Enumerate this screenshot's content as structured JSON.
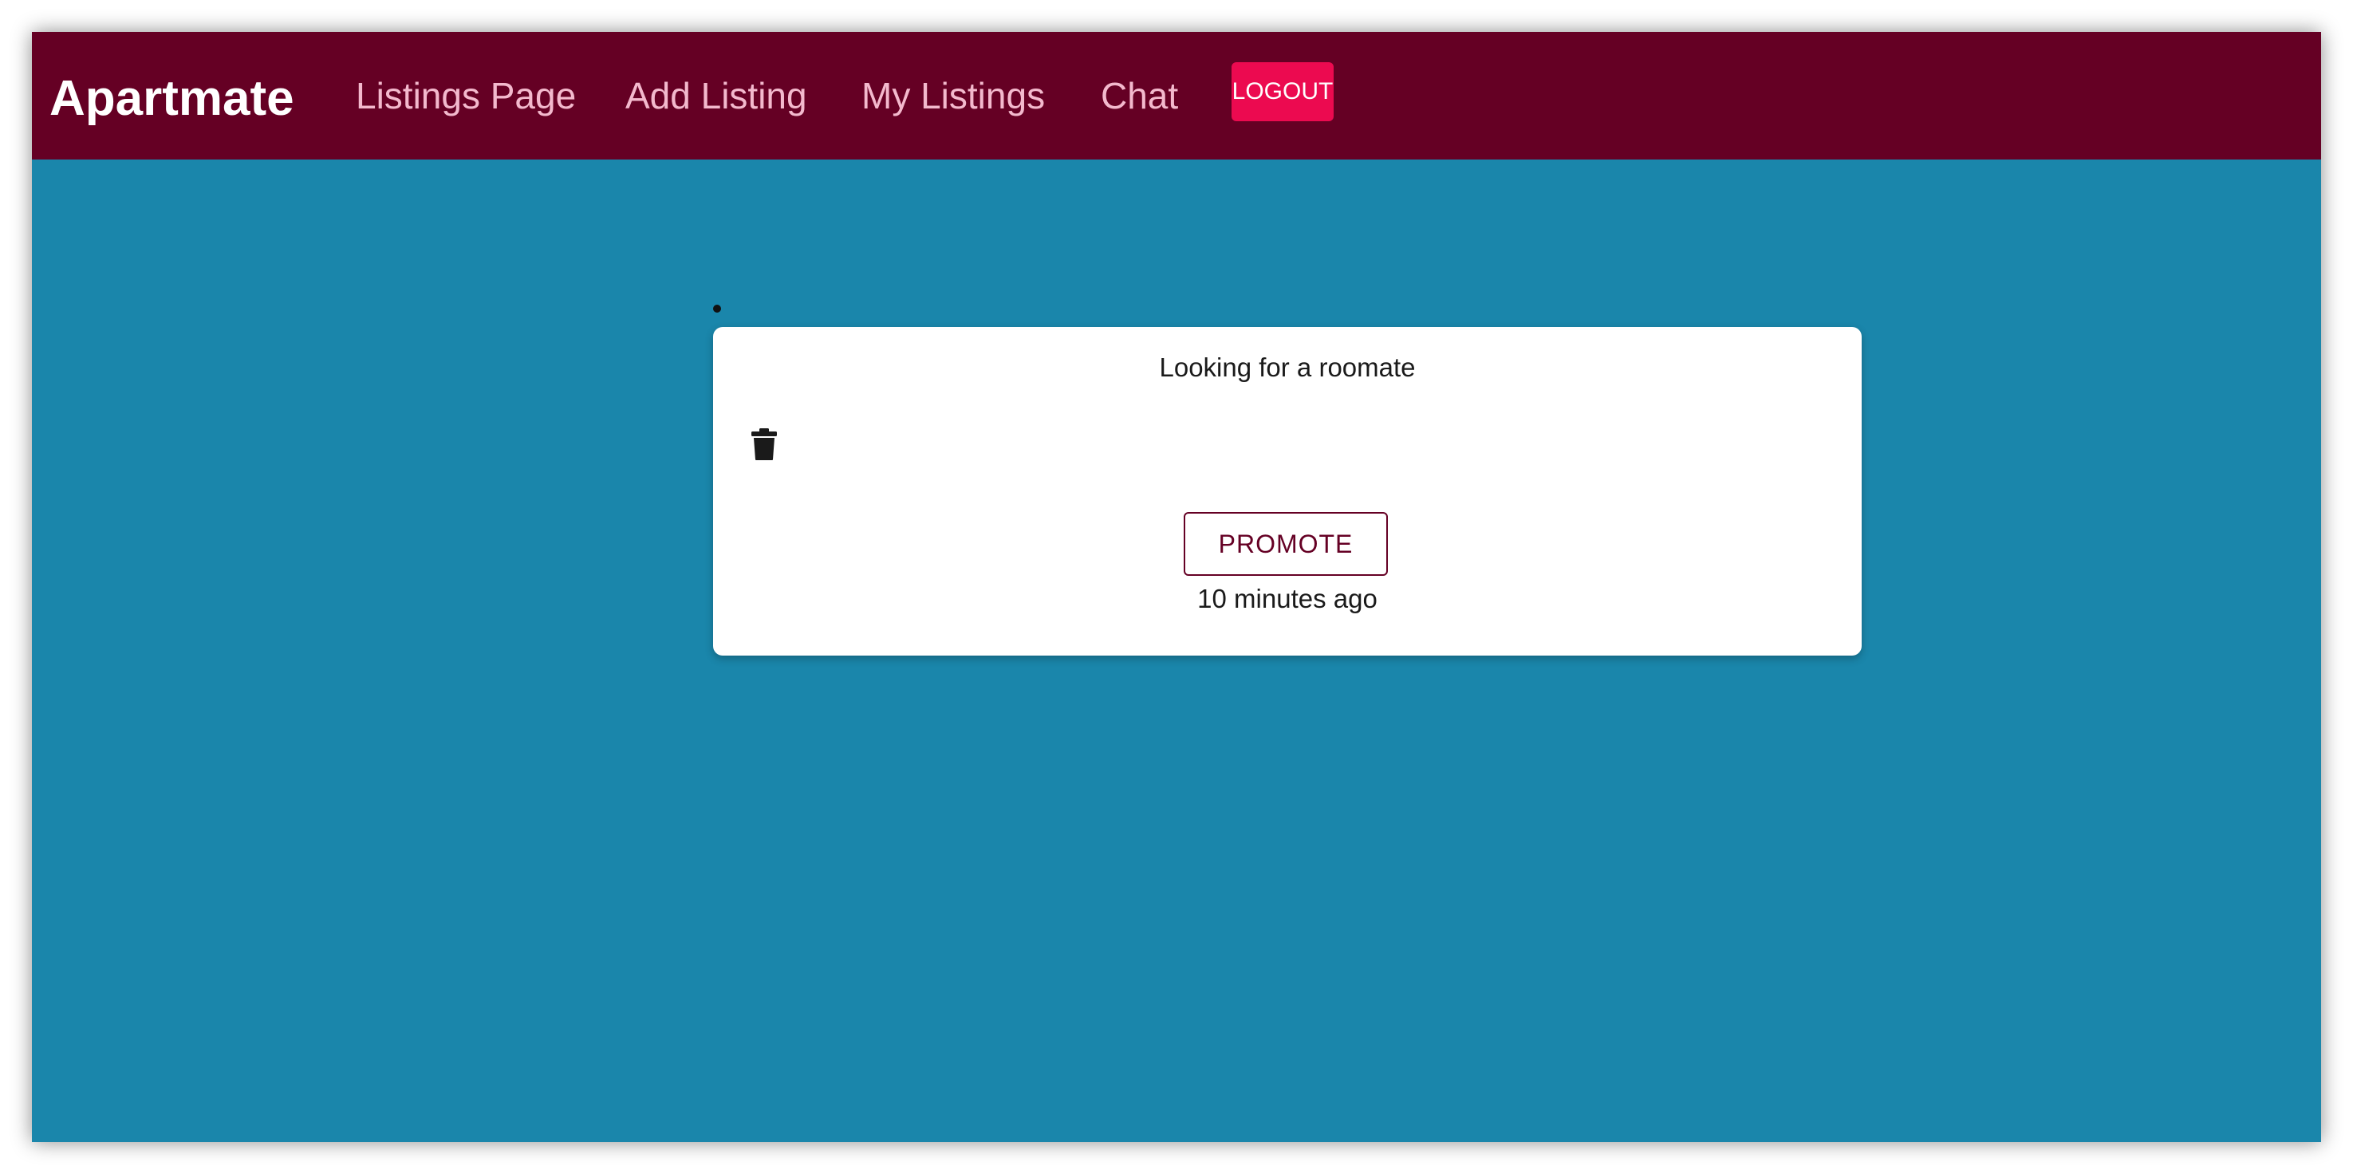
{
  "navbar": {
    "brand": "Apartmate",
    "links": [
      {
        "label": "Listings Page"
      },
      {
        "label": "Add Listing"
      },
      {
        "label": "My Listings"
      },
      {
        "label": "Chat"
      }
    ],
    "logout_label": "LOGOUT",
    "colors": {
      "background": "#650024",
      "link": "#f3b9cd",
      "logout": "#ec0a50"
    }
  },
  "listing": {
    "title": "Looking for a roomate",
    "delete_icon": "trash-icon",
    "promote_label": "PROMOTE",
    "posted": "10 minutes ago"
  },
  "page": {
    "background": "#1a86ab"
  }
}
